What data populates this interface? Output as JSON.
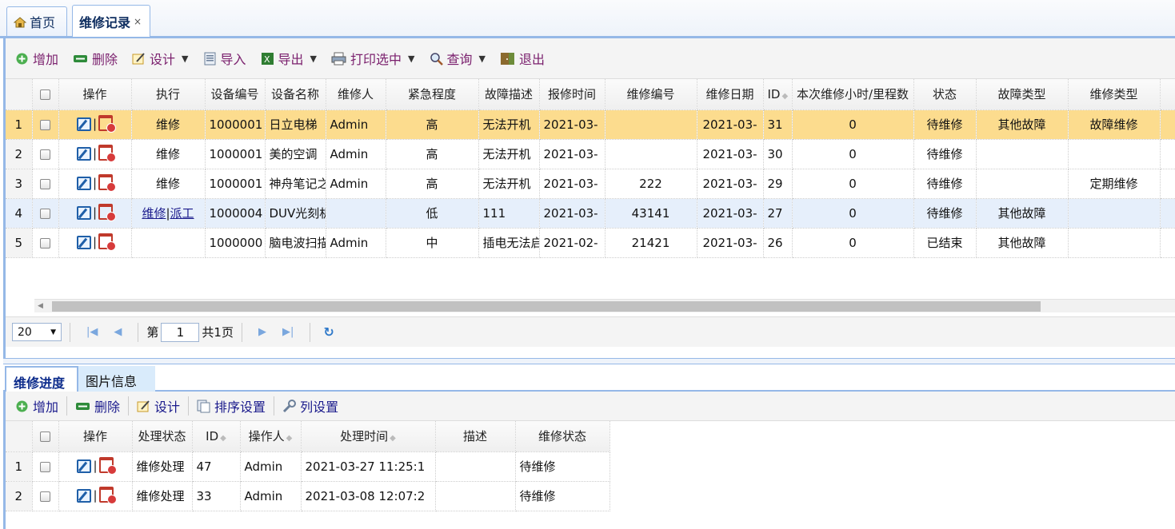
{
  "tabs": [
    {
      "label": "首页",
      "icon": "home-icon"
    },
    {
      "label": "维修记录",
      "close": "×"
    }
  ],
  "toolbar": {
    "add": "增加",
    "delete": "删除",
    "design": "设计",
    "import": "导入",
    "export": "导出",
    "print": "打印选中",
    "query": "查询",
    "exit": "退出"
  },
  "grid": {
    "headers": [
      "操作",
      "执行",
      "设备编号",
      "设备名称",
      "维修人",
      "紧急程度",
      "故障描述",
      "报修时间",
      "维修编号",
      "维修日期",
      "ID",
      "本次维修小时/里程数",
      "状态",
      "故障类型",
      "维修类型"
    ],
    "rows": [
      {
        "n": "1",
        "exec": "维修",
        "exec2": "",
        "code": "1000001",
        "name": "日立电梯",
        "person": "Admin",
        "urgency": "高",
        "fault": "无法开机",
        "report": "2021-03-",
        "rno": "",
        "rdate": "2021-03-",
        "id": "31",
        "hours": "0",
        "status": "待维修",
        "ftype": "其他故障",
        "rtype": "故障维修"
      },
      {
        "n": "2",
        "exec": "维修",
        "exec2": "",
        "code": "1000001",
        "name": "美的空调",
        "person": "Admin",
        "urgency": "高",
        "fault": "无法开机",
        "report": "2021-03-",
        "rno": "",
        "rdate": "2021-03-",
        "id": "30",
        "hours": "0",
        "status": "待维修",
        "ftype": "",
        "rtype": ""
      },
      {
        "n": "3",
        "exec": "维修",
        "exec2": "",
        "code": "1000001",
        "name": "神舟笔记之",
        "person": "Admin",
        "urgency": "高",
        "fault": "无法开机",
        "report": "2021-03-",
        "rno": "222",
        "rdate": "2021-03-",
        "id": "29",
        "hours": "0",
        "status": "待维修",
        "ftype": "",
        "rtype": "定期维修"
      },
      {
        "n": "4",
        "exec": "维修",
        "exec2": "派工",
        "code": "1000004",
        "name": "DUV光刻机",
        "person": "",
        "urgency": "低",
        "fault": "111",
        "report": "2021-03-",
        "rno": "43141",
        "rdate": "2021-03-",
        "id": "27",
        "hours": "0",
        "status": "待维修",
        "ftype": "其他故障",
        "rtype": ""
      },
      {
        "n": "5",
        "exec": "",
        "exec2": "",
        "code": "1000000",
        "name": "脑电波扫描",
        "person": "Admin",
        "urgency": "中",
        "fault": "插电无法启",
        "report": "2021-02-",
        "rno": "21421",
        "rdate": "2021-03-",
        "id": "26",
        "hours": "0",
        "status": "已结束",
        "ftype": "其他故障",
        "rtype": ""
      }
    ]
  },
  "pager": {
    "page_size": "20",
    "page_prefix": "第",
    "page": "1",
    "page_total": "共1页"
  },
  "bottom": {
    "tabs": [
      "维修进度",
      "图片信息"
    ],
    "toolbar": {
      "add": "增加",
      "delete": "删除",
      "design": "设计",
      "sort": "排序设置",
      "cols": "列设置"
    },
    "headers": [
      "操作",
      "处理状态",
      "ID",
      "操作人",
      "处理时间",
      "描述",
      "维修状态"
    ],
    "rows": [
      {
        "n": "1",
        "pstatus": "维修处理",
        "id": "47",
        "op": "Admin",
        "time": "2021-03-27 11:25:1",
        "desc": "",
        "rstatus": "待维修"
      },
      {
        "n": "2",
        "pstatus": "维修处理",
        "id": "33",
        "op": "Admin",
        "time": "2021-03-08 12:07:2",
        "desc": "",
        "rstatus": "待维修"
      }
    ]
  },
  "colors": {
    "border": "#95b8e7",
    "selected_row": "#fcdc8e",
    "hover_row": "#e6effb",
    "toolbar_text": "#7a1f6d"
  }
}
